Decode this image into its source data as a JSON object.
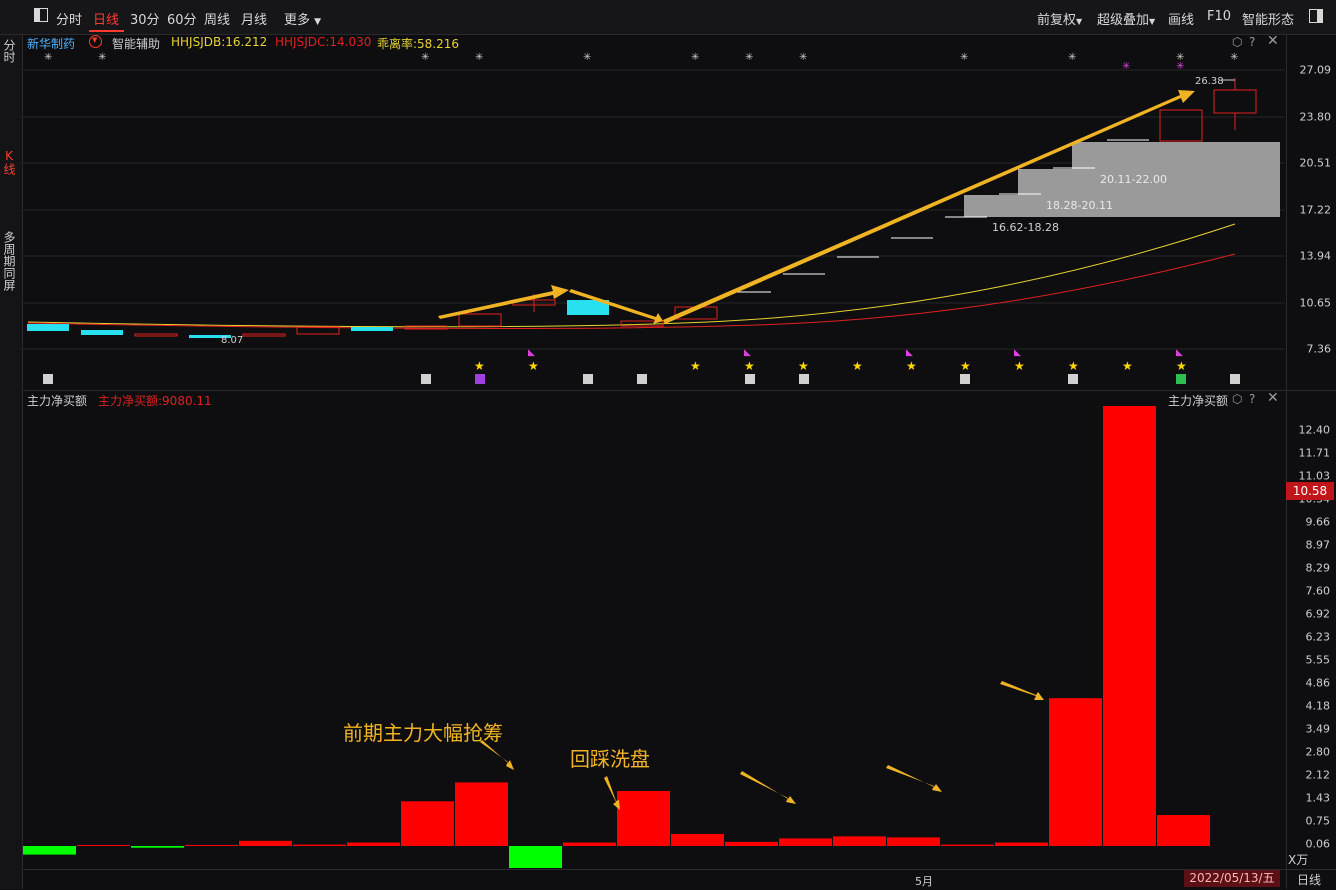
{
  "toolbar": {
    "layout_icon": "panel-toggle-icon",
    "tabs": [
      "分时",
      "日线",
      "30分",
      "60分",
      "周线",
      "月线",
      "更多"
    ],
    "active_tab": "日线",
    "right_items": [
      "前复权",
      "超级叠加",
      "画线",
      "F10",
      "智能形态"
    ]
  },
  "sidebar": {
    "fenshi": "分时",
    "kxian": "K线",
    "multi": "多周期同屏"
  },
  "kline_header": {
    "stock_name": "新华制药",
    "assist": "智能辅助",
    "ind1": "HHJSJDB:16.212",
    "ind2": "HHJSJDC:14.030",
    "ind3": "乖离率:58.216"
  },
  "kline_axis": [
    "27.09",
    "23.80",
    "20.51",
    "17.22",
    "13.94",
    "10.65",
    "7.36"
  ],
  "kline_labels": {
    "high": "26.38",
    "low": "8.07",
    "zone1": "16.62-18.28",
    "zone2": "18.28-20.11",
    "zone3": "20.11-22.00"
  },
  "lower_header": {
    "title": "主力净买额",
    "value": "主力净买额:9080.11",
    "right_title": "主力净买额"
  },
  "lower_axis": [
    "12.40",
    "11.71",
    "11.03",
    "10.34",
    "9.66",
    "8.97",
    "8.29",
    "7.60",
    "6.92",
    "6.23",
    "5.55",
    "4.86",
    "4.18",
    "3.49",
    "2.80",
    "2.12",
    "1.43",
    "0.75",
    "0.06"
  ],
  "lower_unit": "X万",
  "current_value": "10.58",
  "annotations": {
    "a1": "前期主力大幅抢筹",
    "a2": "回踩洗盘"
  },
  "bottom": {
    "month": "5月",
    "date": "2022/05/13/五",
    "period": "日线"
  },
  "colors": {
    "up": "#ff0000",
    "down": "#00ff00",
    "accent_orange": "#f0b323",
    "ma_yellow": "#e6d230",
    "ma_red": "#e02020"
  },
  "chart_data": [
    {
      "type": "bar",
      "title": "主力净买额",
      "ylabel": "X万",
      "ylim": [
        -0.75,
        12.8
      ],
      "values": [
        -0.25,
        0.03,
        -0.05,
        0.03,
        0.15,
        0.04,
        0.1,
        1.3,
        1.85,
        -0.75,
        0.1,
        1.6,
        0.35,
        0.12,
        0.22,
        0.28,
        0.25,
        0.04,
        0.1,
        4.3,
        12.9,
        0.9
      ]
    }
  ]
}
